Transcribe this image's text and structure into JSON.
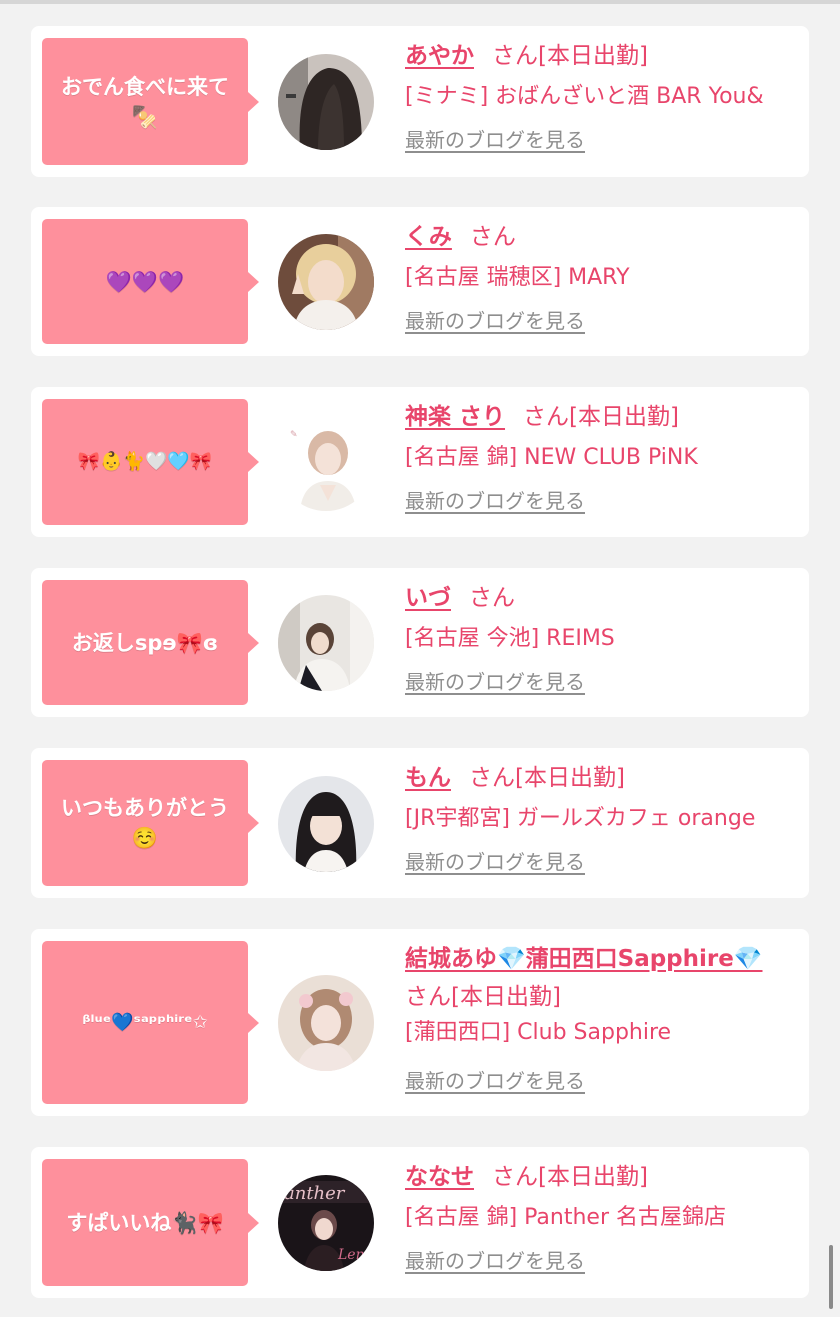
{
  "cards": [
    {
      "bubble": "おでん食べに来て🍢",
      "name": "あやか",
      "san": "さん",
      "status": "[本日出勤]",
      "shop": "[ミナミ] おばんざいと酒 BAR You&",
      "blog": "最新のブログを見る",
      "avatar": "long-dark-hair-photo"
    },
    {
      "bubble": "💜💜💜",
      "name": "くみ",
      "san": "さん",
      "status": "",
      "shop": "[名古屋 瑞穂区] MARY",
      "blog": "最新のブログを見る",
      "avatar": "blonde-peace-sign-photo"
    },
    {
      "bubble": "🎀👶🐈🤍🩵🎀",
      "name": "神楽 さり",
      "san": "さん",
      "status": "[本日出勤]",
      "shop": "[名古屋 錦] NEW CLUB PiNK",
      "blog": "最新のブログを見る",
      "avatar": "white-dress-photo"
    },
    {
      "bubble": "お返しspɘ🎀ɞ",
      "name": "いづ",
      "san": "さん",
      "status": "",
      "shop": "[名古屋 今池] REIMS",
      "blog": "最新のブログを見る",
      "avatar": "mirror-selfie-photo"
    },
    {
      "bubble_line1": "いつもありがとう",
      "bubble_line2": "☺️",
      "name": "もん",
      "san": "さん",
      "status": "[本日出勤]",
      "shop": "[JR宇都宮] ガールズカフェ orange",
      "blog": "最新のブログを見る",
      "avatar": "dark-bangs-photo"
    },
    {
      "bubble": "ᵝˡᵘᵉ💙ˢᵃᵖᵖʰⁱʳᵉ✩",
      "name": "結城あゆ💎蒲田西口Sapphire💎",
      "san": "さん",
      "status": "[本日出勤]",
      "shop": "[蒲田西口] Club Sapphire",
      "blog": "最新のブログを見る",
      "avatar": "flower-hair-photo"
    },
    {
      "bubble": "すぱいいね🐈‍⬛🎀",
      "name": "ななせ",
      "san": "さん",
      "status": "[本日出勤]",
      "shop": "[名古屋 錦] Panther 名古屋錦店",
      "blog": "最新のブログを見る",
      "avatar": "panther-poster-photo"
    }
  ],
  "colors": {
    "accent": "#e8456b",
    "bubble": "#fe909c",
    "background": "#f2f2f2",
    "muted": "#8e8e8e"
  }
}
